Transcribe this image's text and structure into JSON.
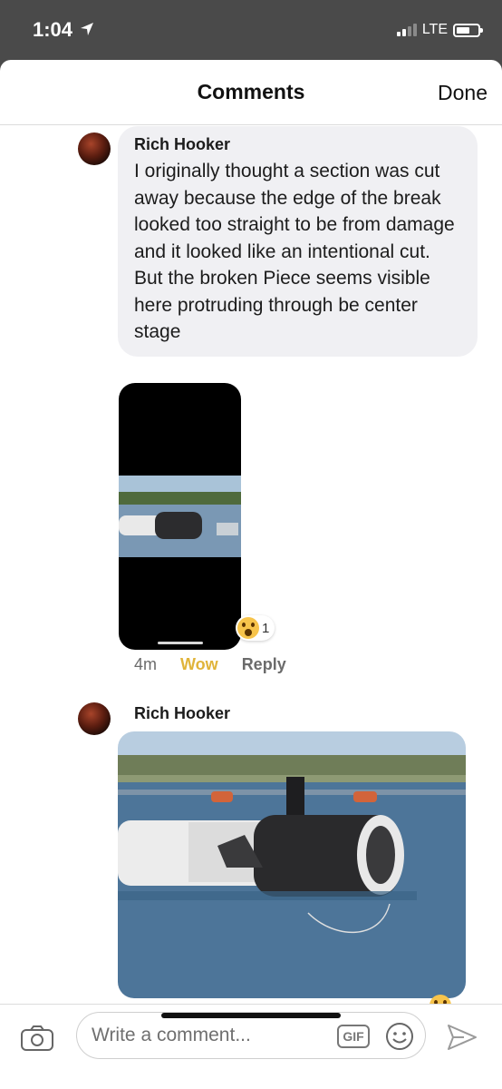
{
  "status": {
    "time": "1:04",
    "network": "LTE"
  },
  "header": {
    "title": "Comments",
    "done_label": "Done"
  },
  "comments": [
    {
      "author": "Rich Hooker",
      "text": "I originally thought a section was cut away because the edge of the break looked  too straight to be from damage and it looked like an intentional cut. But the broken Piece seems visible here protruding through be center stage",
      "reaction_count": "1",
      "time": "4m",
      "wow_label": "Wow",
      "reply_label": "Reply"
    },
    {
      "author": "Rich Hooker"
    }
  ],
  "composer": {
    "placeholder": "Write a comment...",
    "gif_label": "GIF"
  },
  "icons": [
    "location-arrow-icon",
    "signal-icon",
    "battery-icon",
    "camera-icon",
    "gif-icon",
    "emoji-icon",
    "send-icon",
    "wow-reaction-icon"
  ],
  "colors": {
    "wow": "#e0b43a",
    "bubble": "#f0f0f3",
    "status_bar": "#4a4a4a"
  }
}
